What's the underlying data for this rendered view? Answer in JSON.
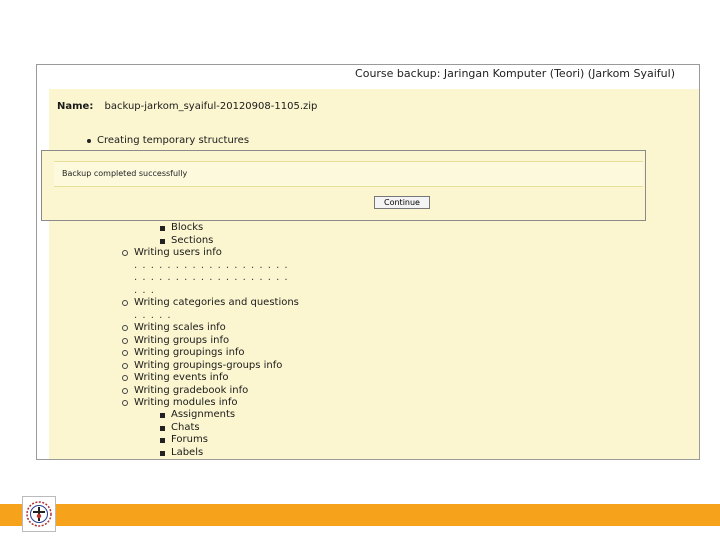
{
  "course_title": "Course backup: Jaringan Komputer (Teori) (Jarkom Syaiful)",
  "backup": {
    "name_label": "Name:",
    "file_name": "backup-jarkom_syaiful-20120908-1105.zip"
  },
  "steps": {
    "top": [
      "Creating temporary structures"
    ],
    "blocks": [
      "Blocks",
      "Sections"
    ],
    "users": "Writing users info",
    "users_dots": [
      ". . .    . . . . . . . . . . . . . . . .",
      ". . .    . . . . . . . . . . . . . . . .",
      ". . ."
    ],
    "categories": "Writing categories and questions",
    "categories_dots": ". . . . .",
    "writing": [
      "Writing scales info",
      "Writing groups info",
      "Writing groupings info",
      "Writing groupings-groups info",
      "Writing events info",
      "Writing gradebook info",
      "Writing modules info"
    ],
    "modules": [
      "Assignments",
      "Chats",
      "Forums",
      "Labels"
    ]
  },
  "dialog": {
    "message": "Backup completed successfully",
    "continue_label": "Continue"
  },
  "colors": {
    "panel": "#fbf6d0",
    "footer": "#f7a21b"
  },
  "icons": {
    "logo": "university-seal-icon"
  }
}
